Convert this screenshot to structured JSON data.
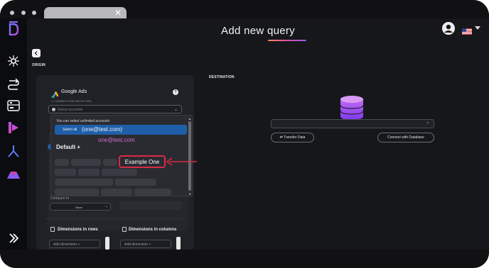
{
  "page": {
    "title": "Add new query"
  },
  "sidebar": {
    "items": [
      {
        "icon": "logo-d-icon"
      },
      {
        "icon": "network-icon"
      },
      {
        "icon": "transfer-icon"
      },
      {
        "icon": "dashboard-icon"
      },
      {
        "icon": "report-icon"
      },
      {
        "icon": "merge-icon"
      },
      {
        "icon": "chart-m-icon"
      },
      {
        "icon": "expand-icon"
      }
    ]
  },
  "origin": {
    "label": "ORIGIN",
    "connector_title": "Google Ads",
    "connections_selected": "1 CONNECTION SELECTED",
    "info_badge": "?",
    "select_placeholder": "Select accounts",
    "dropdown": {
      "hint": "You can select unlimited accounts",
      "select_all": "Select all",
      "account": "(one@test.com)",
      "email": "one@test.com",
      "group": "Default +",
      "highlighted_option": "Example One"
    },
    "compare_label": "Compare to",
    "compare_value": "None",
    "dim_rows_title": "Dimensions in rows",
    "dim_cols_title": "Dimensions in columns",
    "add_dimension": "Add dimension +"
  },
  "destination": {
    "label": "DESTINATION",
    "transfer_btn": "⇄ Transfer Data",
    "connect_btn": "Connect with Database"
  },
  "colors": {
    "accent": "#1f5fa8",
    "highlight": "#d92b45",
    "email": "#d46ad8",
    "db": "#a855f7"
  }
}
